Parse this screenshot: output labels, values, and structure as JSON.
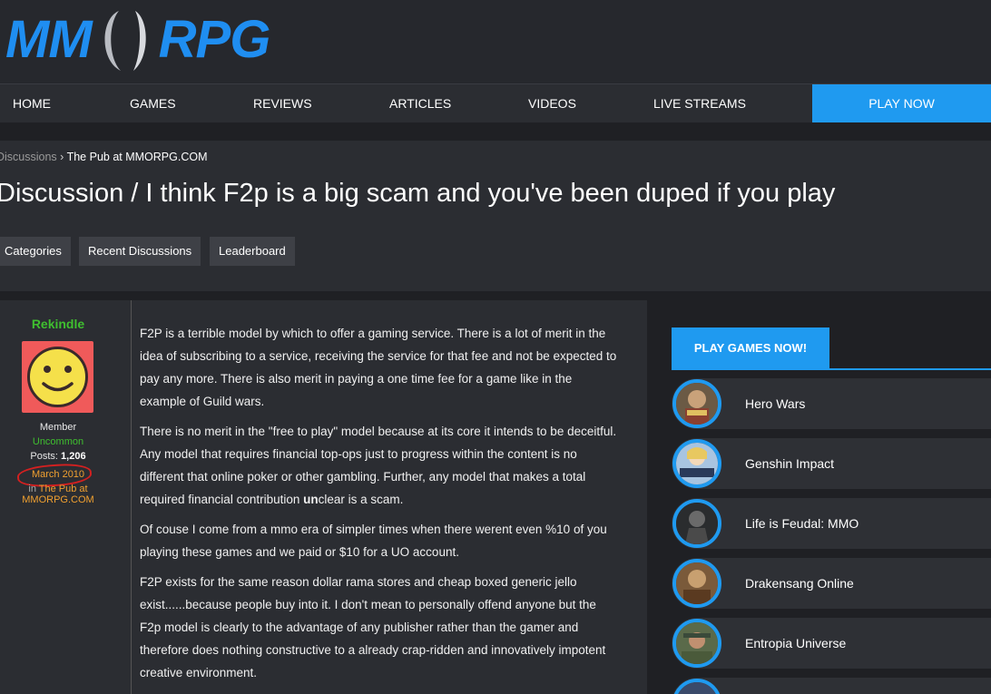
{
  "logo": {
    "left_text": "MM",
    "right_text": "RPG"
  },
  "nav": {
    "items": [
      "HOME",
      "GAMES",
      "REVIEWS",
      "ARTICLES",
      "VIDEOS",
      "LIVE STREAMS"
    ],
    "play_now": "PLAY NOW"
  },
  "breadcrumb": {
    "parent": "Discussions",
    "separator": "›",
    "current": "The Pub at MMORPG.COM"
  },
  "page_title": "Discussion / I think F2p is a big scam and you've been duped if you play",
  "tabs": [
    "Categories",
    "Recent Discussions",
    "Leaderboard"
  ],
  "author": {
    "username": "Rekindle",
    "role": "Member",
    "rank": "Uncommon",
    "posts_label": "Posts:",
    "posts_count": "1,206",
    "join_date": "March 2010",
    "in_label": "in",
    "in_location": "The Pub at",
    "site": "MMORPG.COM"
  },
  "post": {
    "p1": "F2P is a terrible model by which to offer a gaming service.  There is a lot of merit in the idea of subscribing to a service, receiving the service for that fee and not be expected to pay any more. There is also merit in paying a one time fee for a game like in the example of Guild wars.",
    "p2_a": "There is no merit in the \"free to play\" model because at its core it intends to be deceitful.  Any model that requires financial top-ops just to progress within the content is no different that online poker or other gambling.  Further, any model that makes a total required financial contribution ",
    "p2_bold": "un",
    "p2_b": "clear is a scam.",
    "p3": "Of couse I come from a mmo era of simpler times when there werent even %10 of you playing these games and we paid or $10 for a UO account.",
    "p4": "F2P exists for the same reason dollar rama stores and cheap boxed generic jello exist......because people buy into it.  I don't mean to personally offend anyone but the F2p model is clearly to the advantage of any publisher rather than the gamer and therefore does nothing constructive to a already crap-ridden and innovatively impotent creative environment."
  },
  "sidebar": {
    "heading": "PLAY GAMES NOW!",
    "games": [
      "Hero Wars",
      "Genshin Impact",
      "Life is Feudal: MMO",
      "Drakensang Online",
      "Entropia Universe"
    ]
  },
  "colors": {
    "accent": "#1f9af0",
    "page_bg": "#1f2024",
    "panel_bg": "#2b2d32",
    "user_green": "#3fbf2f",
    "meta_orange": "#f0a030"
  }
}
